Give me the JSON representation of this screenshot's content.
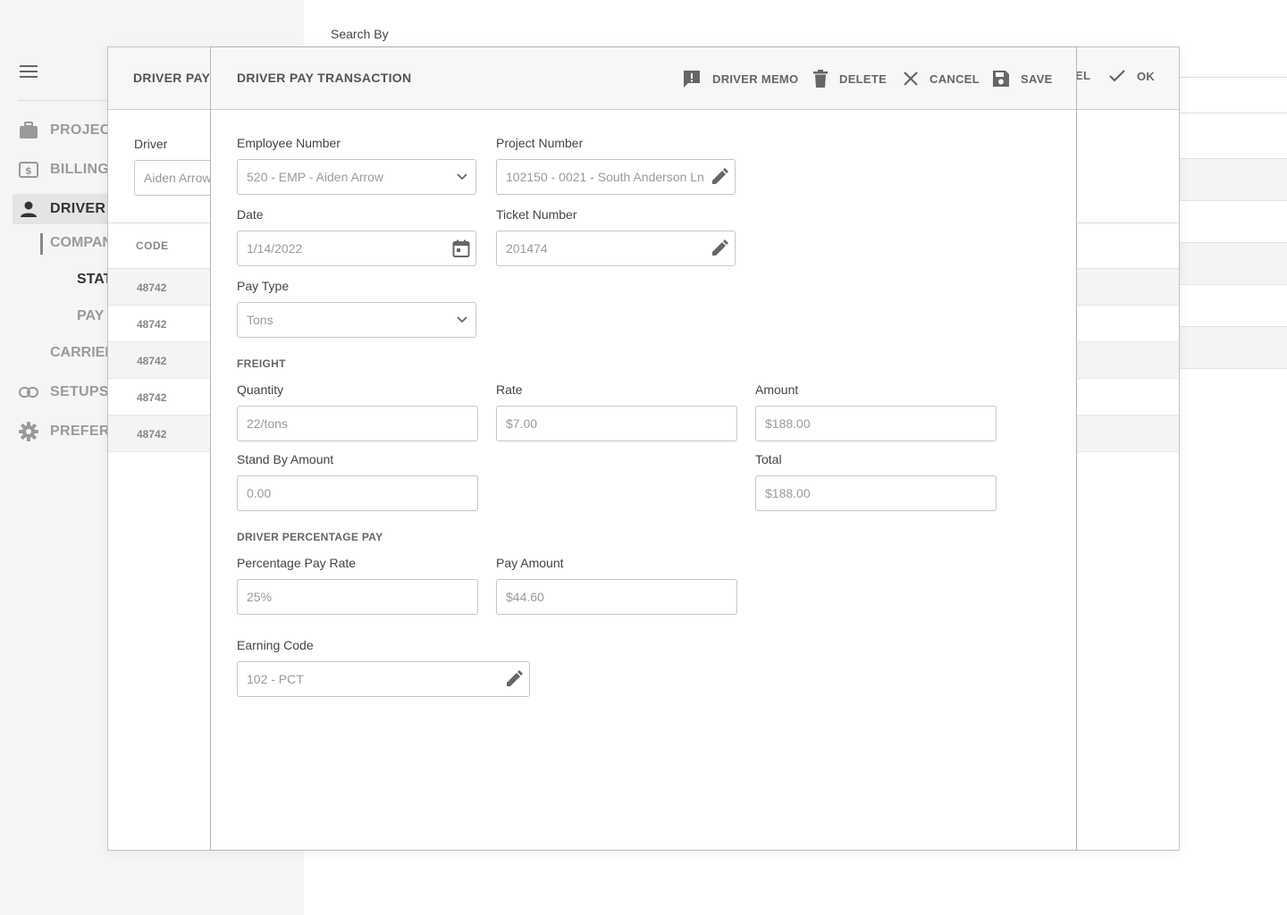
{
  "sidebar": {
    "items": [
      {
        "label": "PROJECT",
        "icon": "briefcase-icon"
      },
      {
        "label": "BILLING",
        "icon": "billing-icon"
      },
      {
        "label": "DRIVER P",
        "icon": "person-icon"
      },
      {
        "label": "SETUPS",
        "icon": "link-icon"
      },
      {
        "label": "PREFERE",
        "icon": "gear-icon"
      }
    ],
    "subitems": {
      "company": "COMPAN",
      "stat": "STAT",
      "pay": "PAY",
      "carrier": "CARRIER"
    }
  },
  "main": {
    "search_label": "Search By"
  },
  "outer_dialog": {
    "title": "DRIVER PAY S",
    "cancel_partial": "EL",
    "ok_label": "OK",
    "driver_label": "Driver",
    "driver_value": "Aiden Arrow",
    "table": {
      "header": "CODE",
      "rows": [
        "48742",
        "48742",
        "48742",
        "48742",
        "48742"
      ]
    }
  },
  "dialog": {
    "title": "DRIVER PAY TRANSACTION",
    "actions": {
      "memo": "DRIVER MEMO",
      "delete": "DELETE",
      "cancel": "CANCEL",
      "save": "SAVE"
    },
    "fields": {
      "employee_number": {
        "label": "Employee Number",
        "value": "520 - EMP - Aiden Arrow"
      },
      "project_number": {
        "label": "Project Number",
        "value": "102150 - 0021 - South Anderson Ln"
      },
      "date": {
        "label": "Date",
        "value": "1/14/2022"
      },
      "ticket_number": {
        "label": "Ticket Number",
        "value": "201474"
      },
      "pay_type": {
        "label": "Pay Type",
        "value": "Tons"
      },
      "quantity": {
        "label": "Quantity",
        "value": "22/tons"
      },
      "rate": {
        "label": "Rate",
        "value": "$7.00"
      },
      "amount": {
        "label": "Amount",
        "value": "$188.00"
      },
      "stand_by_amount": {
        "label": "Stand By Amount",
        "value": "0.00"
      },
      "total": {
        "label": "Total",
        "value": "$188.00"
      },
      "percentage_pay_rate": {
        "label": "Percentage Pay Rate",
        "value": "25%"
      },
      "pay_amount": {
        "label": "Pay Amount",
        "value": "$44.60"
      },
      "earning_code": {
        "label": "Earning Code",
        "value": "102 - PCT"
      }
    },
    "sections": {
      "freight": "FREIGHT",
      "driver_percentage_pay": "DRIVER PERCENTAGE PAY"
    }
  },
  "colors": {
    "icon_gray": "#6b6b6b",
    "text_muted": "#9a9a9a",
    "border": "#c6c6c6",
    "active_nav": "#e4e4e4"
  }
}
